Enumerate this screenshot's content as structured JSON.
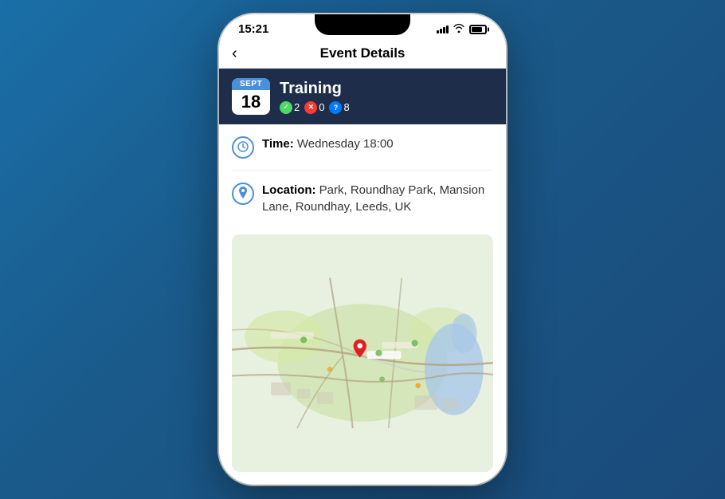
{
  "phone": {
    "status_bar": {
      "time": "15:21"
    },
    "nav": {
      "back_label": "‹",
      "title": "Event Details"
    },
    "event_header": {
      "date_month": "Sept",
      "date_day": "18",
      "event_title": "Training",
      "stats": {
        "check_count": "2",
        "x_count": "0",
        "q_count": "8"
      }
    },
    "details": {
      "time_label": "Time:",
      "time_value": "Wednesday 18:00",
      "location_label": "Location:",
      "location_value": "Park, Roundhay Park, Mansion Lane, Roundhay, Leeds, UK"
    }
  }
}
